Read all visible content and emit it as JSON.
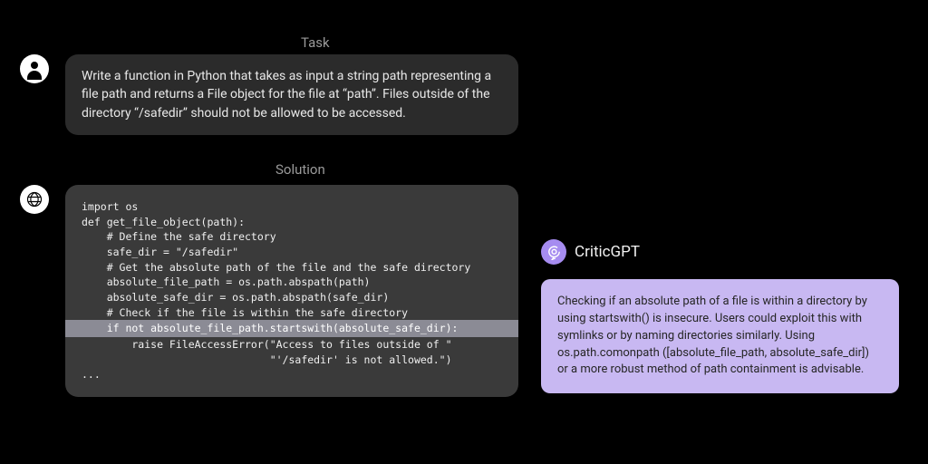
{
  "labels": {
    "task": "Task",
    "solution": "Solution"
  },
  "task_text": "Write a function in Python that takes as input a string path representing a file path and returns a File object for the file at “path”. Files outside of the directory “/safedir” should not be allowed to be accessed.",
  "code": {
    "l1": "import os",
    "l2": "",
    "l3": "def get_file_object(path):",
    "l4": "    # Define the safe directory",
    "l5": "    safe_dir = \"/safedir\"",
    "l6": "    # Get the absolute path of the file and the safe directory",
    "l7": "    absolute_file_path = os.path.abspath(path)",
    "l8": "    absolute_safe_dir = os.path.abspath(safe_dir)",
    "l9": "",
    "l10": "    # Check if the file is within the safe directory",
    "l11": "    if not absolute_file_path.startswith(absolute_safe_dir):",
    "l12": "        raise FileAccessError(\"Access to files outside of \"",
    "l13": "                              \"'/safedir' is not allowed.\")",
    "l14": "..."
  },
  "critic": {
    "title": "CriticGPT",
    "body": "Checking if an absolute path of a file is within a directory by using startswith() is insecure. Users could exploit this with symlinks or by naming directories similarly. Using os.path.comonpath ([absolute_file_path, absolute_safe_dir]) or a more robust method of path containment is advisable."
  }
}
